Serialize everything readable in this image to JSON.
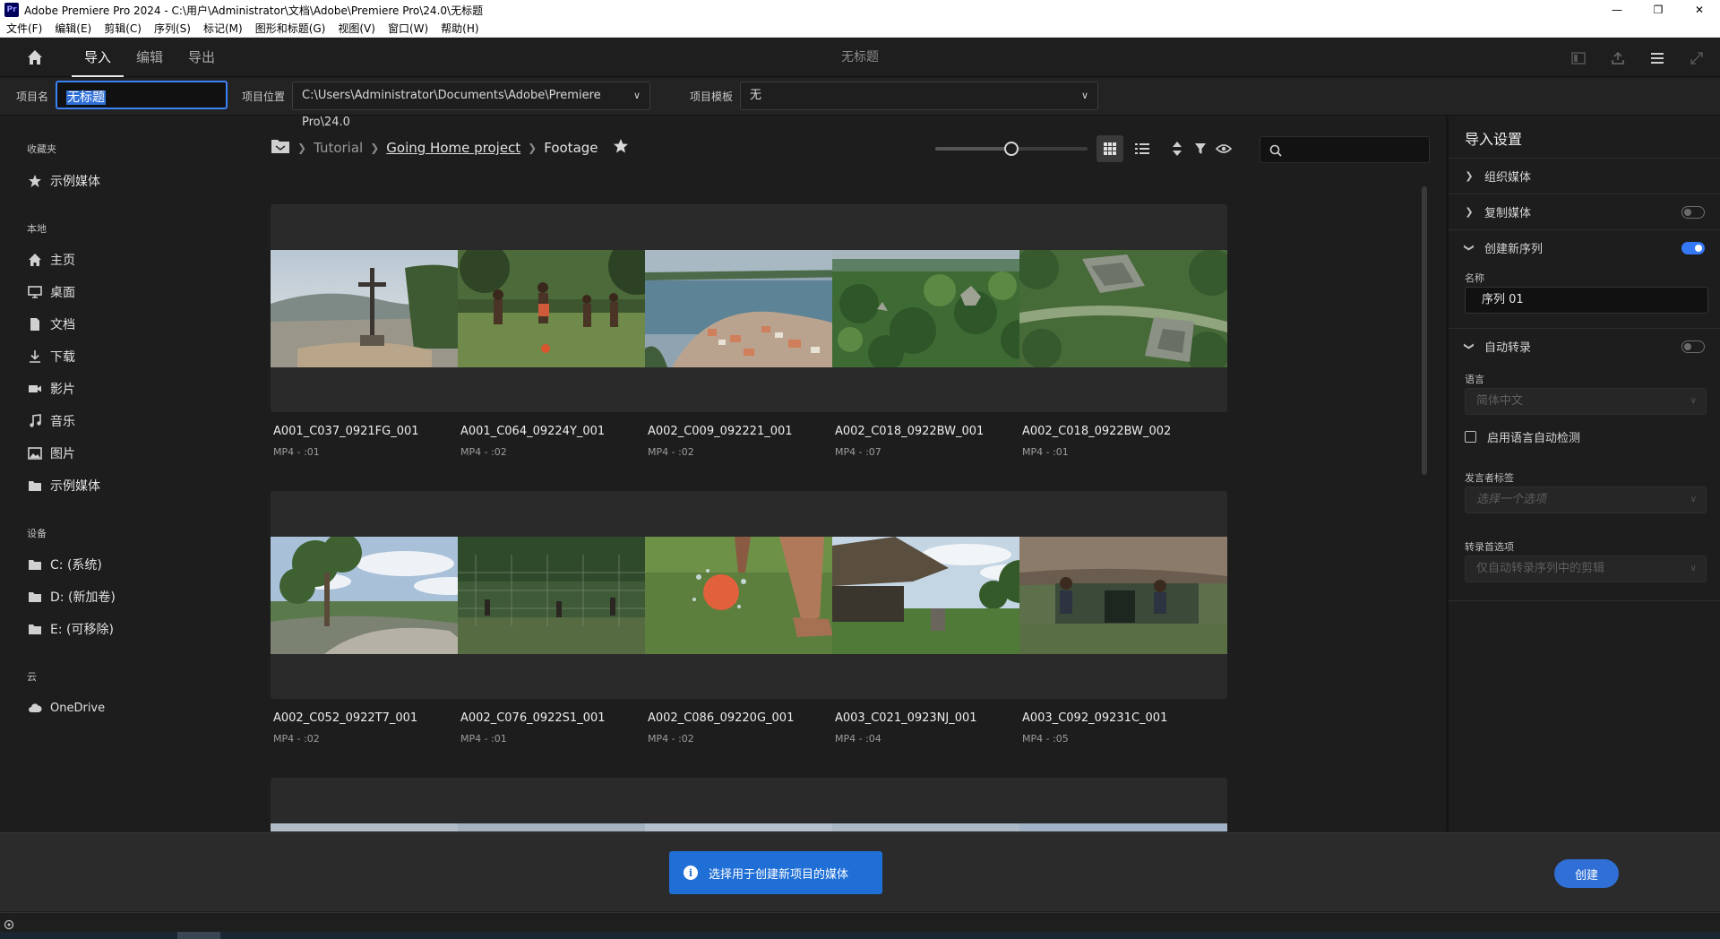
{
  "window": {
    "title": "Adobe Premiere Pro 2024 - C:\\用户\\Administrator\\文档\\Adobe\\Premiere Pro\\24.0\\无标题",
    "app_icon_text": "Pr"
  },
  "menu": [
    "文件(F)",
    "编辑(E)",
    "剪辑(C)",
    "序列(S)",
    "标记(M)",
    "图形和标题(G)",
    "视图(V)",
    "窗口(W)",
    "帮助(H)"
  ],
  "header": {
    "tabs": [
      "导入",
      "编辑",
      "导出"
    ],
    "active_tab": "导入",
    "title": "无标题"
  },
  "project": {
    "name_label": "项目名",
    "name_value": "无标题",
    "location_label": "项目位置",
    "location_value": "C:\\Users\\Administrator\\Documents\\Adobe\\Premiere Pro\\24.0",
    "template_label": "项目模板",
    "template_value": "无"
  },
  "sidebar": {
    "favorites_heading": "收藏夹",
    "favorites": [
      {
        "label": "示例媒体",
        "icon": "star-icon"
      }
    ],
    "local_heading": "本地",
    "local": [
      {
        "label": "主页",
        "icon": "home-icon"
      },
      {
        "label": "桌面",
        "icon": "desktop-icon"
      },
      {
        "label": "文档",
        "icon": "document-icon"
      },
      {
        "label": "下载",
        "icon": "download-icon"
      },
      {
        "label": "影片",
        "icon": "video-icon"
      },
      {
        "label": "音乐",
        "icon": "music-icon"
      },
      {
        "label": "图片",
        "icon": "image-icon"
      },
      {
        "label": "示例媒体",
        "icon": "folder-icon"
      }
    ],
    "devices_heading": "设备",
    "devices": [
      {
        "label": "C: (系统)",
        "icon": "folder-icon"
      },
      {
        "label": "D: (新加卷)",
        "icon": "folder-icon"
      },
      {
        "label": "E: (可移除)",
        "icon": "folder-icon"
      }
    ],
    "cloud_heading": "云",
    "cloud": [
      {
        "label": "OneDrive",
        "icon": "cloud-icon"
      }
    ]
  },
  "breadcrumb": {
    "items": [
      "Tutorial",
      "Going Home project",
      "Footage"
    ]
  },
  "toolbar": {
    "zoom_fraction": 0.5,
    "search_placeholder": ""
  },
  "media": [
    {
      "name": "A001_C037_0921FG_001",
      "meta": "MP4 - :01",
      "thumb": "cross-hill"
    },
    {
      "name": "A001_C064_09224Y_001",
      "meta": "MP4 - :02",
      "thumb": "soccer-kids"
    },
    {
      "name": "A002_C009_092221_001",
      "meta": "MP4 - :02",
      "thumb": "island-town"
    },
    {
      "name": "A002_C018_0922BW_001",
      "meta": "MP4 - :07",
      "thumb": "jungle-aerial"
    },
    {
      "name": "A002_C018_0922BW_002",
      "meta": "MP4 - :01",
      "thumb": "temple-aerial"
    },
    {
      "name": "A002_C052_0922T7_001",
      "meta": "MP4 - :02",
      "thumb": "tree-rock"
    },
    {
      "name": "A002_C076_0922S1_001",
      "meta": "MP4 - :01",
      "thumb": "fence-field"
    },
    {
      "name": "A002_C086_09220G_001",
      "meta": "MP4 - :02",
      "thumb": "ball-kick"
    },
    {
      "name": "A003_C021_0923NJ_001",
      "meta": "MP4 - :04",
      "thumb": "hut-grass"
    },
    {
      "name": "A003_C092_09231C_001",
      "meta": "MP4 - :05",
      "thumb": "hut-kids"
    },
    {
      "name": "",
      "meta": "",
      "thumb": "sky-1"
    },
    {
      "name": "",
      "meta": "",
      "thumb": "sky-2"
    },
    {
      "name": "",
      "meta": "",
      "thumb": "sky-3"
    },
    {
      "name": "",
      "meta": "",
      "thumb": "sky-4"
    },
    {
      "name": "",
      "meta": "",
      "thumb": "sky-5"
    }
  ],
  "import_settings": {
    "title": "导入设置",
    "organize_media": "组织媒体",
    "copy_media": "复制媒体",
    "copy_media_on": false,
    "create_sequence": "创建新序列",
    "create_sequence_on": true,
    "name_label": "名称",
    "sequence_name": "序列 01",
    "auto_transcribe": "自动转录",
    "auto_transcribe_on": false,
    "language_label": "语言",
    "language_value": "简体中文",
    "auto_detect_label": "启用语言自动检测",
    "speaker_label": "发言者标签",
    "speaker_placeholder": "选择一个选项",
    "transcribe_pref_label": "转录首选项",
    "transcribe_pref_value": "仅自动转录序列中的剪辑"
  },
  "footer": {
    "hint": "选择用于创建新项目的媒体",
    "create_button": "创建"
  },
  "colors": {
    "accent": "#2f6fd6",
    "panel": "#1d1d1d",
    "card": "#2a2a2a"
  }
}
